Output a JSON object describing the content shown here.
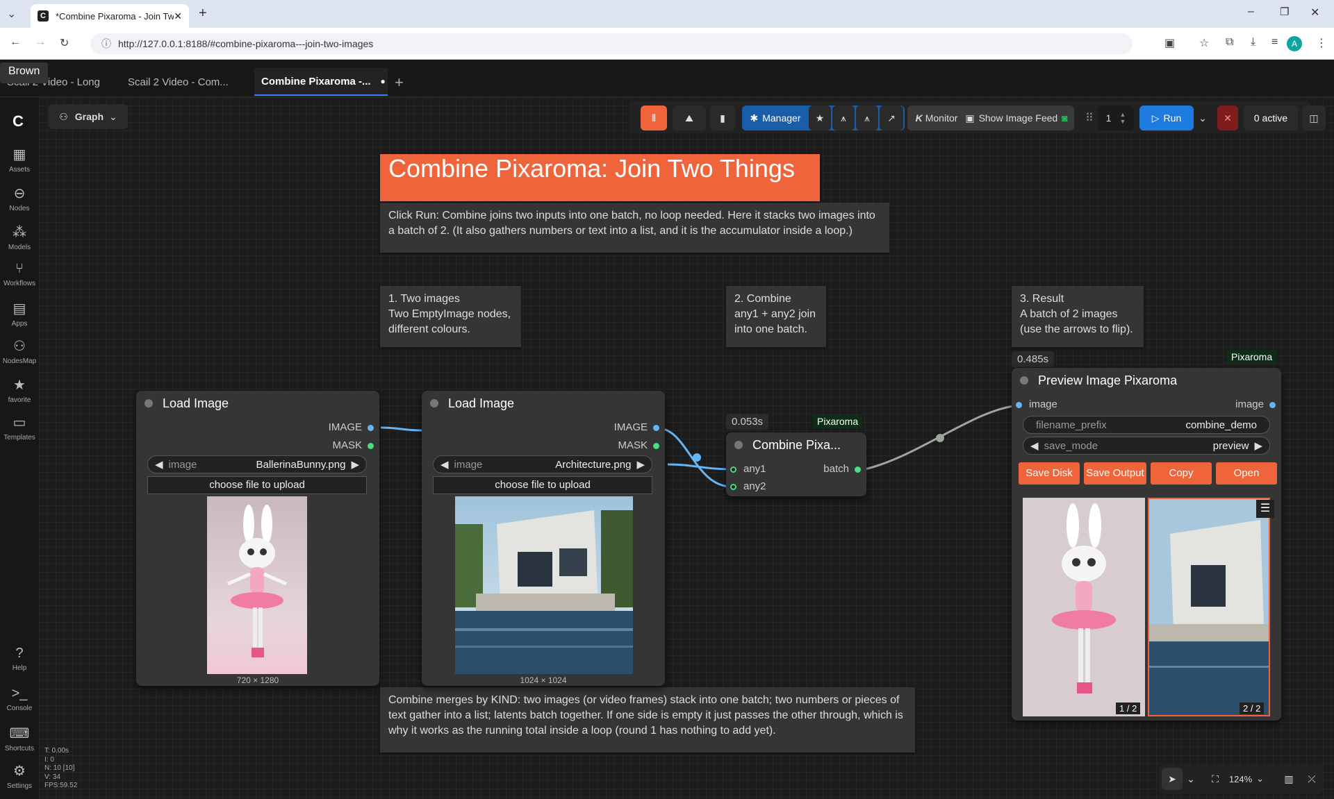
{
  "browser": {
    "tab_title": "*Combine Pixaroma - Join Two",
    "url": "http://127.0.0.1:8188/#combine-pixaroma---join-two-images",
    "profile_initial": "A"
  },
  "tooltip": "Brown",
  "workflow_tabs": [
    {
      "label": "Scail 2 Video - Long"
    },
    {
      "label": "Scail 2 Video - Com..."
    },
    {
      "label": "Combine Pixaroma -..."
    }
  ],
  "graph_label": "Graph",
  "sidebar": [
    {
      "label": "Assets"
    },
    {
      "label": "Nodes"
    },
    {
      "label": "Models"
    },
    {
      "label": "Workflows"
    },
    {
      "label": "Apps"
    },
    {
      "label": "NodesMap"
    },
    {
      "label": "favorite"
    },
    {
      "label": "Templates"
    },
    {
      "label": "Help"
    },
    {
      "label": "Console"
    },
    {
      "label": "Shortcuts"
    },
    {
      "label": "Settings"
    }
  ],
  "toolbar": {
    "manager": "Manager",
    "monitor": "Monitor",
    "show_image_feed": "Show Image Feed",
    "queue_count": "1",
    "run": "Run",
    "active": "0 active"
  },
  "notes": {
    "title": "Combine Pixaroma: Join Two Things",
    "intro": "Click Run: Combine joins two inputs into one batch, no loop needed. Here it stacks two images into a batch of 2. (It also gathers numbers or text into a list, and it is the accumulator inside a loop.)",
    "step1": "1. Two images\nTwo EmptyImage nodes,\ndifferent colours.",
    "step2": "2. Combine\nany1 + any2 join\ninto one batch.",
    "step3": "3. Result\nA batch of 2 images\n(use the arrows to flip).",
    "bottom": "Combine merges by KIND: two images (or video frames) stack into one batch; two numbers or pieces of text gather into a list; latents batch together. If one side is empty it just passes the other through, which is why it works as the running total inside a loop (round 1 has nothing to add yet)."
  },
  "nodes": {
    "load1": {
      "title": "Load Image",
      "out1": "IMAGE",
      "out2": "MASK",
      "widget_label": "image",
      "widget_value": "BallerinaBunny.png",
      "upload": "choose file to upload",
      "dims": "720 × 1280"
    },
    "load2": {
      "title": "Load Image",
      "out1": "IMAGE",
      "out2": "MASK",
      "widget_label": "image",
      "widget_value": "Architecture.png",
      "upload": "choose file to upload",
      "dims": "1024 × 1024"
    },
    "combine": {
      "title": "Combine Pixa...",
      "in1": "any1",
      "in2": "any2",
      "out": "batch",
      "time": "0.053s",
      "badge": "Pixaroma"
    },
    "preview": {
      "title": "Preview Image Pixaroma",
      "in": "image",
      "out": "image",
      "time": "0.485s",
      "badge": "Pixaroma",
      "prefix_label": "filename_prefix",
      "prefix_value": "combine_demo",
      "mode_label": "save_mode",
      "mode_value": "preview",
      "btn_save_disk": "Save Disk",
      "btn_save_output": "Save Output",
      "btn_copy": "Copy",
      "btn_open": "Open",
      "img1_counter": "1 / 2",
      "img2_counter": "2 / 2"
    }
  },
  "stats": {
    "t": "T: 0.00s",
    "i": "I: 0",
    "n": "N: 10 [10]",
    "v": "V: 34",
    "fps": "FPS:59.52"
  },
  "zoom": "124%",
  "colors": {
    "accent": "#f0643c",
    "run": "#1d7be0",
    "manager": "#1a5da8",
    "link_image": "#64b5f6",
    "link_any": "#9aa79a"
  }
}
